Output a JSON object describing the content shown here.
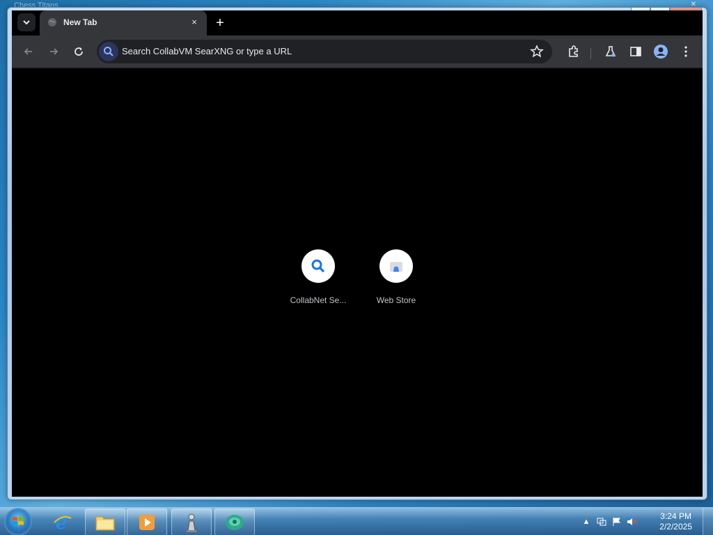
{
  "background_window": {
    "title": "Chess Titans"
  },
  "window": {
    "buttons": {
      "minimize": "▁",
      "maximize": "❐",
      "close": "✕"
    }
  },
  "tabs": [
    {
      "title": "New Tab",
      "close": "×"
    }
  ],
  "new_tab": {
    "symbol": "+"
  },
  "toolbar": {
    "omnibox_placeholder": "Search CollabVM SearXNG or type a URL"
  },
  "shortcuts": [
    {
      "label": "CollabNet Se...",
      "icon": "search-icon"
    },
    {
      "label": "Web Store",
      "icon": "web-store-icon"
    }
  ],
  "taskbar": {
    "pinned": [
      "internet-explorer",
      "file-explorer",
      "media-player",
      "chess-titans",
      "chromium"
    ]
  },
  "tray": {
    "time": "3:24 PM",
    "date": "2/2/2025",
    "expand": "▲"
  },
  "colors": {
    "accent": "#8ab4f8",
    "tab_bg": "#35363a",
    "content_bg": "#000000"
  }
}
